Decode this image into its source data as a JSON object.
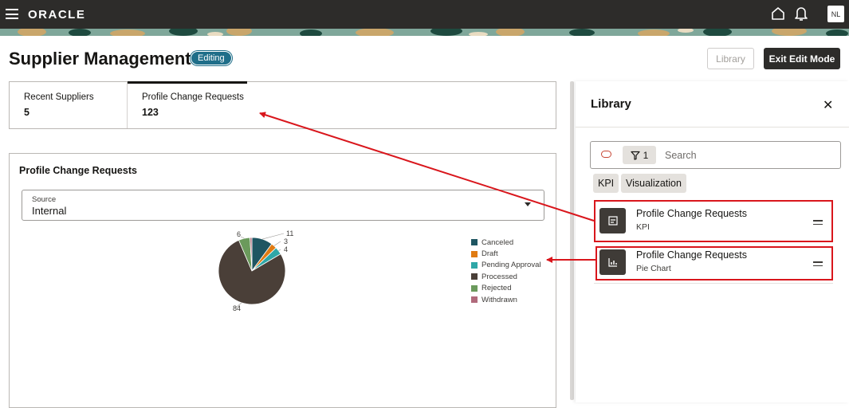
{
  "header": {
    "brand": "ORACLE",
    "avatar_initials": "NL"
  },
  "page": {
    "title": "Supplier Management",
    "status_badge": "Editing",
    "library_button": "Library",
    "exit_button": "Exit Edit Mode"
  },
  "kpis": [
    {
      "label": "Recent Suppliers",
      "value": "5"
    },
    {
      "label": "Profile Change Requests",
      "value": "123"
    }
  ],
  "chart_card": {
    "title": "Profile Change Requests",
    "source_label": "Source",
    "source_value": "Internal"
  },
  "chart_data": {
    "type": "pie",
    "categories": [
      "Canceled",
      "Draft",
      "Pending Approval",
      "Processed",
      "Rejected",
      "Withdrawn"
    ],
    "values": [
      11,
      3,
      4,
      84,
      6,
      1
    ],
    "data_labels": [
      "11",
      "3",
      "4",
      "84",
      "6",
      ""
    ],
    "colors": [
      "#1f5662",
      "#e07b12",
      "#2fa7a7",
      "#4a3f38",
      "#6b9a5c",
      "#b06a7b"
    ],
    "legend_position": "right"
  },
  "library": {
    "title": "Library",
    "filter_count": "1",
    "search_placeholder": "Search",
    "type_chips": [
      "KPI",
      "Visualization"
    ],
    "items": [
      {
        "name": "Profile Change Requests",
        "type": "KPI"
      },
      {
        "name": "Profile Change Requests",
        "type": "Pie Chart"
      }
    ]
  },
  "colors": {
    "header_bg": "#2d2c2a",
    "badge_bg": "#1f6e89",
    "annotation_red": "#d9161c"
  }
}
